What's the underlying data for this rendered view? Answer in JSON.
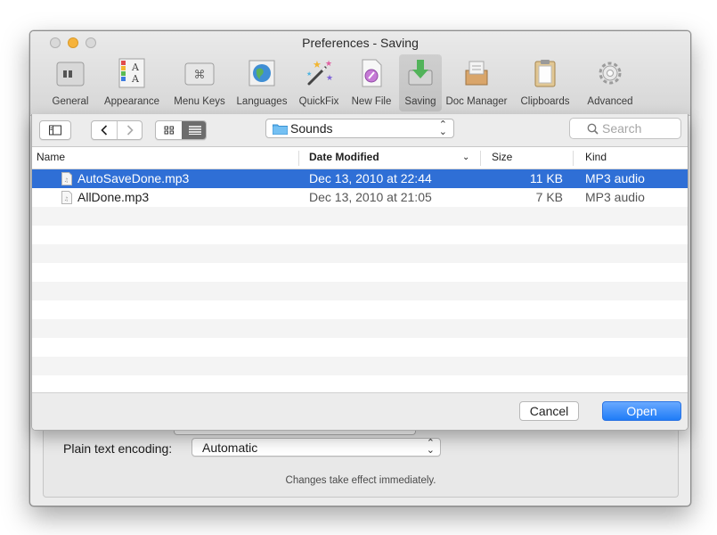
{
  "window": {
    "title": "Preferences - Saving"
  },
  "toolbar": {
    "items": [
      {
        "label": "General",
        "icon": "general-icon"
      },
      {
        "label": "Appearance",
        "icon": "appearance-icon"
      },
      {
        "label": "Menu Keys",
        "icon": "menu-keys-icon"
      },
      {
        "label": "Languages",
        "icon": "languages-icon"
      },
      {
        "label": "QuickFix",
        "icon": "quickfix-wand-icon"
      },
      {
        "label": "New File",
        "icon": "new-file-icon"
      },
      {
        "label": "Saving",
        "icon": "saving-icon",
        "selected": true
      },
      {
        "label": "Doc Manager",
        "icon": "doc-manager-icon"
      },
      {
        "label": "Clipboards",
        "icon": "clipboard-icon"
      },
      {
        "label": "Advanced",
        "icon": "gear-icon"
      }
    ]
  },
  "open_sheet": {
    "folder": "Sounds",
    "search_placeholder": "Search",
    "columns": {
      "name": "Name",
      "date_modified": "Date Modified",
      "size": "Size",
      "kind": "Kind"
    },
    "files": [
      {
        "name": "AutoSaveDone.mp3",
        "date": "Dec 13, 2010 at 22:44",
        "size": "11 KB",
        "kind": "MP3 audio",
        "selected": true
      },
      {
        "name": "AllDone.mp3",
        "date": "Dec 13, 2010 at 21:05",
        "size": "7 KB",
        "kind": "MP3 audio",
        "selected": false
      }
    ],
    "cancel_label": "Cancel",
    "open_label": "Open"
  },
  "saving_panel": {
    "encoding_label": "Plain text encoding:",
    "encoding_value": "Automatic",
    "note": "Changes take effect immediately."
  },
  "colors": {
    "selection": "#2f6fd6",
    "accent_button": "#1f7cf7"
  }
}
